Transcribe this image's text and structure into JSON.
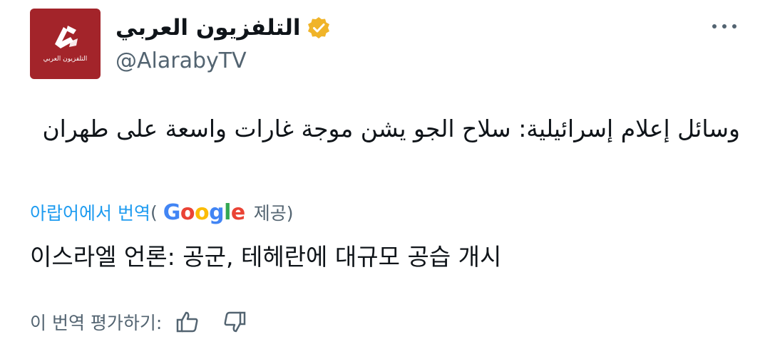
{
  "account": {
    "display_name": "التلفزيون العربي",
    "handle": "@AlarabyTV",
    "avatar_caption": "التلفزيون العربي",
    "verified_color": "#f0b429",
    "avatar_color": "#a3242a"
  },
  "tweet": {
    "text": "وسائل إعلام إسرائيلية: سلاح الجو يشن موجة غارات واسعة على طهران"
  },
  "translation": {
    "link_label": "아랍어에서 번역",
    "open_paren": "(",
    "google_letters": [
      "G",
      "o",
      "o",
      "g",
      "l",
      "e"
    ],
    "provided_label": "제공)",
    "translated_text": "이스라엘 언론: 공군, 테헤란에 대규모 공습 개시"
  },
  "rating": {
    "label": "이 번역 평가하기:"
  },
  "icons": {
    "more": "more-horizontal-icon",
    "verified": "verified-badge-icon",
    "thumbs_up": "thumbs-up-icon",
    "thumbs_down": "thumbs-down-icon"
  },
  "colors": {
    "link": "#1d9bf0",
    "secondary_text": "#536471",
    "primary_text": "#0f1419"
  }
}
